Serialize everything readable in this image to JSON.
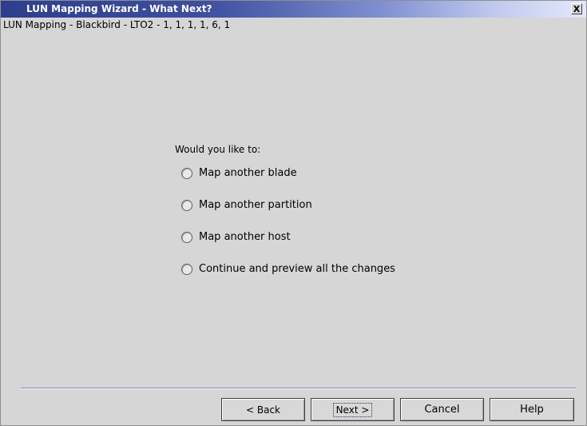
{
  "window": {
    "title": "LUN Mapping Wizard - What Next?",
    "close_label": "X"
  },
  "header": {
    "subtitle": "LUN Mapping - Blackbird - LTO2 - 1, 1, 1, 1, 6, 1"
  },
  "question": {
    "prompt": "Would you like to:",
    "options": [
      {
        "label": "Map another blade",
        "selected": false
      },
      {
        "label": "Map another partition",
        "selected": false
      },
      {
        "label": "Map another host",
        "selected": false
      },
      {
        "label": "Continue and preview all the changes",
        "selected": false
      }
    ]
  },
  "buttons": {
    "back": "< Back",
    "next": "Next >",
    "cancel": "Cancel",
    "help": "Help"
  }
}
